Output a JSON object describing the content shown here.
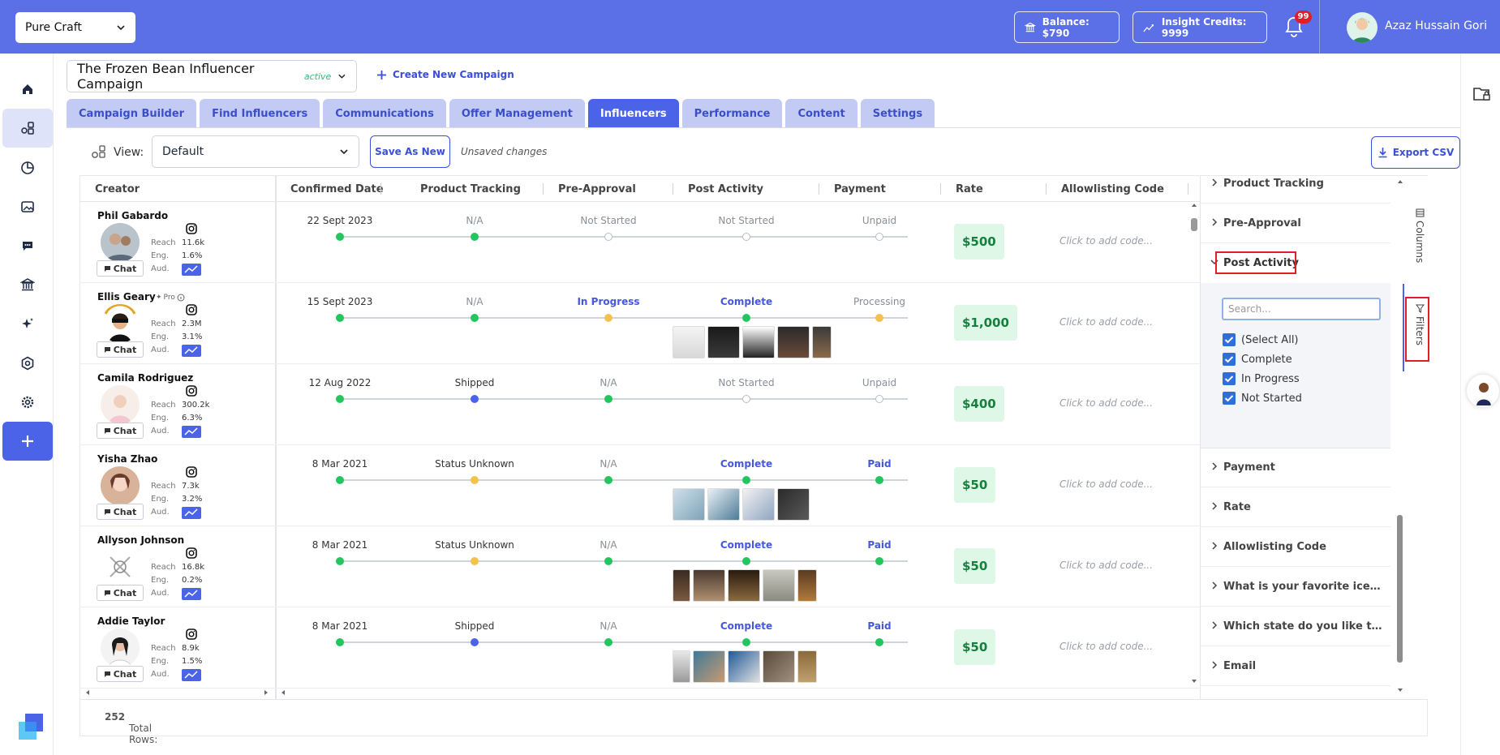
{
  "topbar": {
    "brand": "Pure Craft",
    "balance": "Balance: $790",
    "credits": "Insight Credits: 9999",
    "notifications": "99",
    "user": "Azaz Hussain Gori"
  },
  "campaign": {
    "name": "The Frozen Bean Influencer Campaign",
    "status": "active",
    "create_new": "Create New Campaign"
  },
  "tabs": [
    "Campaign Builder",
    "Find Influencers",
    "Communications",
    "Offer Management",
    "Influencers",
    "Performance",
    "Content",
    "Settings"
  ],
  "toolbar": {
    "view_label": "View:",
    "view_value": "Default",
    "save_as_new": "Save As New",
    "unsaved": "Unsaved changes",
    "export": "Export CSV"
  },
  "columns": {
    "creator": "Creator",
    "confirmed": "Confirmed Date",
    "tracking": "Product Tracking",
    "preapproval": "Pre-Approval",
    "postactivity": "Post Activity",
    "payment": "Payment",
    "rate": "Rate",
    "allowlisting": "Allowlisting Code"
  },
  "labels": {
    "reach": "Reach",
    "eng": "Eng.",
    "aud": "Aud.",
    "chat": "Chat",
    "pro": "Pro",
    "add_code": "Click to add code..."
  },
  "rows": [
    {
      "name": "Phil Gabardo",
      "reach": "11.6k",
      "eng": "1.6%",
      "date": "22 Sept 2023",
      "tracking": "N/A",
      "preapproval": "Not Started",
      "post": "Not Started",
      "payment": "Unpaid",
      "rate": "$500",
      "thumbs": 0
    },
    {
      "name": "Ellis Geary",
      "reach": "2.3M",
      "eng": "3.1%",
      "date": "15 Sept 2023",
      "tracking": "N/A",
      "preapproval": "In Progress",
      "post": "Complete",
      "payment": "Processing",
      "rate": "$1,000",
      "thumbs": 5
    },
    {
      "name": "Camila Rodriguez",
      "reach": "300.2k",
      "eng": "6.3%",
      "date": "12 Aug 2022",
      "tracking": "Shipped",
      "preapproval": "N/A",
      "post": "Not Started",
      "payment": "Unpaid",
      "rate": "$400",
      "thumbs": 0
    },
    {
      "name": "Yisha Zhao",
      "reach": "7.3k",
      "eng": "3.2%",
      "date": "8 Mar 2021",
      "tracking": "Status Unknown",
      "preapproval": "N/A",
      "post": "Complete",
      "payment": "Paid",
      "rate": "$50",
      "thumbs": 4
    },
    {
      "name": "Allyson Johnson",
      "reach": "16.8k",
      "eng": "0.2%",
      "date": "8 Mar 2021",
      "tracking": "Status Unknown",
      "preapproval": "N/A",
      "post": "Complete",
      "payment": "Paid",
      "rate": "$50",
      "thumbs": 5
    },
    {
      "name": "Addie Taylor",
      "reach": "8.9k",
      "eng": "1.5%",
      "date": "8 Mar 2021",
      "tracking": "Shipped",
      "preapproval": "N/A",
      "post": "Complete",
      "payment": "Paid",
      "rate": "$50",
      "thumbs": 5
    }
  ],
  "footer": {
    "label": "Total Rows:",
    "count": "252"
  },
  "filters": {
    "sections_top": [
      "Product Tracking",
      "Pre-Approval",
      "Post Activity"
    ],
    "search_placeholder": "Search...",
    "options": [
      "(Select All)",
      "Complete",
      "In Progress",
      "Not Started"
    ],
    "sections_bottom": [
      "Payment",
      "Rate",
      "Allowlisting Code",
      "What is your favorite ice crea...",
      "Which state do you like to buy...",
      "Email"
    ]
  },
  "sidetabs": {
    "columns": "Columns",
    "filters": "Filters"
  },
  "colors": {
    "accent": "#4a63e7",
    "topbar": "#5b6fe6",
    "complete": "#22c55e",
    "pending": "#f3c24d",
    "highlight": "#e11d2a"
  }
}
